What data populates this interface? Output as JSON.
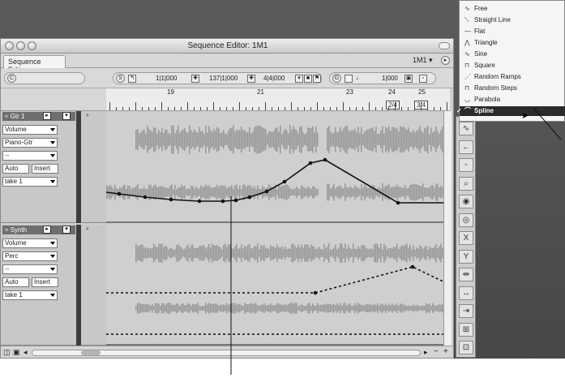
{
  "window": {
    "title": "Sequence Editor: 1M1",
    "tab": "Sequence Editor",
    "menu_id": "1M1 ▾"
  },
  "toolbar": {
    "c_label": "C",
    "s_label": "S",
    "g_label": "G",
    "position_1": "1|1|000",
    "position_2": "137|1|000",
    "position_3": "4|4|000",
    "position_4": "1|000"
  },
  "ruler": {
    "bars": [
      "19",
      "21",
      "23",
      "24",
      "25"
    ],
    "timesig": [
      "2/4",
      "3/4"
    ]
  },
  "tracks": [
    {
      "name": "Gtr 1",
      "param": "Volume",
      "instrument": "Piano-Gtr",
      "third": "--",
      "mode": "Auto",
      "insert": "Insert",
      "take": "take 1"
    },
    {
      "name": "Synth",
      "param": "Volume",
      "instrument": "Perc",
      "third": "--",
      "mode": "Auto",
      "insert": "Insert",
      "take": "take 1"
    }
  ],
  "menu": {
    "items": [
      {
        "label": "Free",
        "icon": "freehand-icon",
        "glyph": "∿"
      },
      {
        "label": "Straight Line",
        "icon": "straight-line-icon",
        "glyph": "⟍"
      },
      {
        "label": "Flat",
        "icon": "flat-icon",
        "glyph": "—"
      },
      {
        "label": "Triangle",
        "icon": "triangle-wave-icon",
        "glyph": "⋀"
      },
      {
        "label": "Sine",
        "icon": "sine-wave-icon",
        "glyph": "∿"
      },
      {
        "label": "Square",
        "icon": "square-wave-icon",
        "glyph": "⊓"
      },
      {
        "label": "Random Ramps",
        "icon": "random-ramps-icon",
        "glyph": "⋰"
      },
      {
        "label": "Random Steps",
        "icon": "random-steps-icon",
        "glyph": "⊓"
      },
      {
        "label": "Parabola",
        "icon": "parabola-icon",
        "glyph": "◡"
      },
      {
        "label": "Spline",
        "icon": "spline-icon",
        "glyph": "⌒",
        "selected": true,
        "check": "✓"
      }
    ]
  },
  "palette_tools": [
    "∿",
    "←",
    "◦",
    "⌕",
    "◉",
    "◎",
    "X",
    "Y",
    "⇹",
    "↔",
    "⇥",
    "⊞",
    "⊡"
  ]
}
